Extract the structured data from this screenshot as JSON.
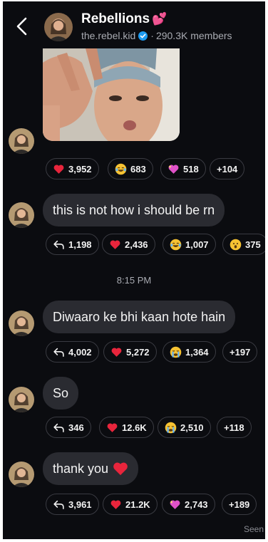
{
  "header": {
    "title": "Rebellions",
    "title_emoji": "💕",
    "handle": "the.rebel.kid",
    "separator": "·",
    "members": "290.3K members"
  },
  "messages": [
    {
      "type": "image",
      "reactions": [
        {
          "icon": "heart-icon",
          "count": "3,952"
        },
        {
          "icon": "laughing-emoji-icon",
          "count": "683"
        },
        {
          "icon": "sparkling-heart-icon",
          "count": "518"
        },
        {
          "icon": "",
          "count": "+104"
        }
      ]
    },
    {
      "type": "text",
      "text": "this is not how i should be rn",
      "reactions": [
        {
          "icon": "reply-icon",
          "count": "1,198"
        },
        {
          "icon": "heart-icon",
          "count": "2,436"
        },
        {
          "icon": "laughing-emoji-icon",
          "count": "1,007"
        },
        {
          "icon": "surprised-emoji-icon",
          "count": "375"
        }
      ]
    },
    {
      "type": "text",
      "text": "Diwaaro ke bhi kaan hote hain",
      "reactions": [
        {
          "icon": "reply-icon",
          "count": "4,002"
        },
        {
          "icon": "heart-icon",
          "count": "5,272"
        },
        {
          "icon": "crying-emoji-icon",
          "count": "1,364"
        },
        {
          "icon": "",
          "count": "+197"
        }
      ]
    },
    {
      "type": "text",
      "text": "So",
      "reactions": [
        {
          "icon": "reply-icon",
          "count": "346"
        },
        {
          "icon": "heart-icon",
          "count": "12.6K"
        },
        {
          "icon": "crying-emoji-icon",
          "count": "2,510"
        },
        {
          "icon": "",
          "count": "+118"
        }
      ]
    },
    {
      "type": "text",
      "text": "thank you",
      "reactions": [
        {
          "icon": "reply-icon",
          "count": "3,961"
        },
        {
          "icon": "heart-icon",
          "count": "21.2K"
        },
        {
          "icon": "sparkling-heart-icon",
          "count": "2,743"
        },
        {
          "icon": "",
          "count": "+189"
        }
      ]
    }
  ],
  "timestamp": "8:15 PM",
  "seen_label": "Seen",
  "colors": {
    "background": "#0b0c10",
    "bubble": "#2a2b31",
    "chip_border": "#3a3b42",
    "heart": "#e8253c",
    "verified": "#1d9bf0",
    "sparkling_heart": "#e052c8"
  }
}
